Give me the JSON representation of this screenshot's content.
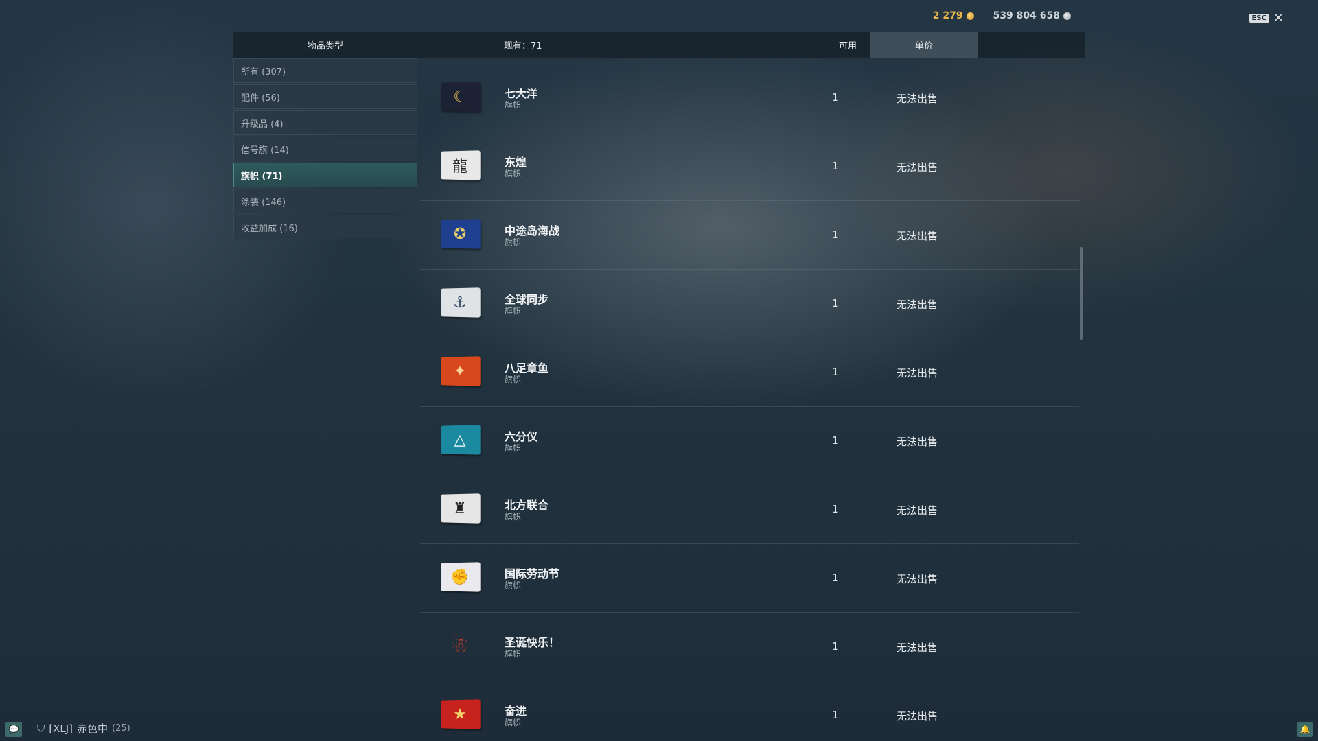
{
  "currency": {
    "gold": "2 279",
    "credits": "539 804 658",
    "gold_color": "#e8b54a"
  },
  "close": {
    "esc_label": "ESC",
    "close_glyph": "×"
  },
  "header": {
    "type_label": "物品类型",
    "have_label": "现有：71",
    "available_label": "可用",
    "price_label": "单价"
  },
  "sidebar": {
    "items": [
      {
        "label": "所有 (307)",
        "active": false
      },
      {
        "label": "配件 (56)",
        "active": false
      },
      {
        "label": "升级品 (4)",
        "active": false
      },
      {
        "label": "信号旗 (14)",
        "active": false
      },
      {
        "label": "旗帜 (71)",
        "active": true
      },
      {
        "label": "涂装 (146)",
        "active": false
      },
      {
        "label": "收益加成 (16)",
        "active": false
      }
    ]
  },
  "items": [
    {
      "name": "七大洋",
      "type": "旗帜",
      "qty": "1",
      "price": "无法出售",
      "icon": "seven-seas-flag-icon",
      "glyph": "☾",
      "bg": "#1c2233",
      "fg": "#e6c15a"
    },
    {
      "name": "东煌",
      "type": "旗帜",
      "qty": "1",
      "price": "无法出售",
      "icon": "dragon-flag-icon",
      "glyph": "龍",
      "bg": "#e8e8e8",
      "fg": "#222222"
    },
    {
      "name": "中途岛海战",
      "type": "旗帜",
      "qty": "1",
      "price": "无法出售",
      "icon": "midway-flag-icon",
      "glyph": "✪",
      "bg": "#1f3f8f",
      "fg": "#e8cf6a"
    },
    {
      "name": "全球同步",
      "type": "旗帜",
      "qty": "1",
      "price": "无法出售",
      "icon": "global-sync-flag-icon",
      "glyph": "⚓",
      "bg": "#dfe3e6",
      "fg": "#2a3d5a"
    },
    {
      "name": "八足章鱼",
      "type": "旗帜",
      "qty": "1",
      "price": "无法出售",
      "icon": "octopus-flag-icon",
      "glyph": "✦",
      "bg": "#d9481c",
      "fg": "#f7d59a"
    },
    {
      "name": "六分仪",
      "type": "旗帜",
      "qty": "1",
      "price": "无法出售",
      "icon": "sextant-flag-icon",
      "glyph": "△",
      "bg": "#1b8aa0",
      "fg": "#ffffff"
    },
    {
      "name": "北方联合",
      "type": "旗帜",
      "qty": "1",
      "price": "无法出售",
      "icon": "northern-union-flag-icon",
      "glyph": "♜",
      "bg": "#e6e6e6",
      "fg": "#222222"
    },
    {
      "name": "国际劳动节",
      "type": "旗帜",
      "qty": "1",
      "price": "无法出售",
      "icon": "labor-day-flag-icon",
      "glyph": "✊",
      "bg": "#e9e9ee",
      "fg": "#4a3aa8"
    },
    {
      "name": "圣诞快乐！",
      "type": "旗帜",
      "qty": "1",
      "price": "无法出售",
      "icon": "santa-flag-icon",
      "glyph": "☃",
      "bg": "transparent",
      "fg": "#d03a2a"
    },
    {
      "name": "奋进",
      "type": "旗帜",
      "qty": "1",
      "price": "无法出售",
      "icon": "endeavor-flag-icon",
      "glyph": "★",
      "bg": "#c8221f",
      "fg": "#f3d36a"
    }
  ],
  "status": {
    "clan": "[XLJ]",
    "player": "赤色中",
    "level": "(25)"
  }
}
